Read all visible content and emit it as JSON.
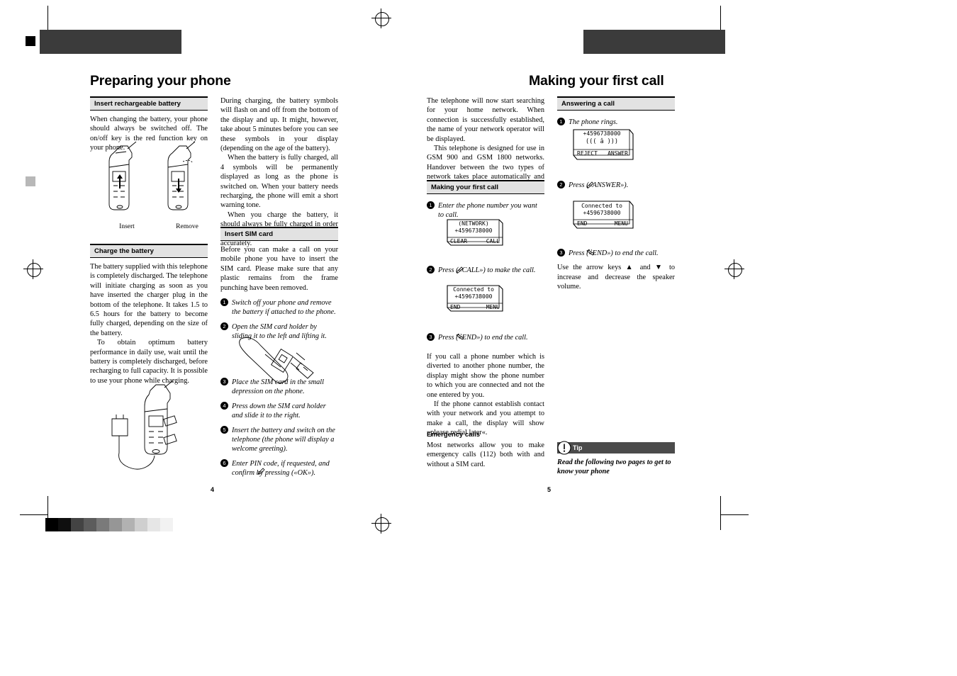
{
  "document": {
    "left_page": {
      "title": "Preparing your phone",
      "page_number": "4",
      "sections": [
        {
          "heading": "Insert rechargeable battery",
          "body": "When changing the battery, your phone should always be switched off. The on/off key is the red function key on your phone.",
          "figure_captions": [
            "Insert",
            "Remove"
          ]
        },
        {
          "heading": "Charge the battery",
          "paragraphs": [
            "The battery supplied with this telephone is completely discharged. The telephone will initiate charging as soon as you have inserted the charger plug in the bottom of the telephone. It takes 1.5 to 6.5 hours for the battery to become fully charged, depending on the size of the battery.",
            "To obtain optimum battery performance in daily use, wait until the battery is completely discharged, before recharging to full capacity. It is possible to use your phone while charging."
          ]
        },
        {
          "heading": "Insert SIM card",
          "intro": "Before you can make a call on your mobile phone you have to insert the SIM card. Please make sure that any plastic remains from the frame punching have been removed.",
          "steps": [
            "Switch off your phone and remove the battery if attached to the phone.",
            "Open the SIM card holder by sliding it to the left and lifting it.",
            "Place the SIM card in the small depression on the phone.",
            "Press down the SIM card holder and slide it to the right.",
            "Insert the battery and switch on the telephone (the phone will display a welcome greeting).",
            "Enter PIN code, if requested, and confirm by pressing  («OK»)."
          ]
        }
      ],
      "column2_paragraphs": [
        "During charging, the battery symbols will flash on and off from the bottom of the display and up. It might, however, take about 5 minutes before you can see these symbols in your display (depending on the age of the battery).",
        "When the battery is fully charged, all 4 symbols will be permanently displayed as long as the phone is switched on. When your battery needs recharging, the phone will emit a short warning tone.",
        "When you charge the battery, it should always be fully charged in order to read out the battery capacity accurately."
      ]
    },
    "right_page": {
      "title": "Making your first call",
      "page_number": "5",
      "column1": {
        "paragraphs": [
          "The telephone will now start searching for your home network. When connection is successfully established, the name of your network operator will be displayed.",
          "This telephone is designed for use in GSM 900 and GSM 1800 networks. Handover between the two types of network takes place automatically and seamlessly."
        ],
        "section_heading": "Making your first call",
        "steps": [
          "Enter the phone number you want to call.",
          "Press  («CALL») to make the call.",
          "Press  («END») to end the call."
        ],
        "after_paragraphs": [
          "If you call a phone number which is diverted to another phone number, the display might show the phone number to which you are connected and not the one entered by you.",
          "If the phone cannot establish contact with your network and you attempt to make a call, the display will show »please redial later«."
        ],
        "emergency_heading": "Emergency calls",
        "emergency_body": "Most networks allow you to make emergency calls (112) both with and without a SIM card.",
        "lcd_1": {
          "line1": "(NETWORK)",
          "line2": "+4596738000",
          "soft_left": "CLEAR",
          "soft_right": "CALL"
        },
        "lcd_2": {
          "line1": "Connected to",
          "line2": "+4596738000",
          "soft_left": "END",
          "soft_right": "MENU"
        }
      },
      "column2": {
        "section_heading": "Answering a call",
        "steps": [
          "The phone rings.",
          "Press  («ANSWER»).",
          "Press  («END») to end the call."
        ],
        "volume_note": "Use the arrow keys ▲ and ▼ to increase and decrease the speaker volume.",
        "lcd_ring": {
          "line1": "+4596738000",
          "line2": "((( â )))",
          "soft_left": "REJECT",
          "soft_right": "ANSWER"
        },
        "lcd_connected": {
          "line1": "Connected to",
          "line2": "+4596738000",
          "soft_left": "END",
          "soft_right": "MENU"
        },
        "tip_label": "Tip",
        "tip_body": "Read the following two pages to get to know your phone"
      }
    }
  },
  "colors": {
    "header_bar": "#3b3b3b",
    "section_heading_bg": "#e2e2e2",
    "tip_bg": "#4b4b4b"
  }
}
